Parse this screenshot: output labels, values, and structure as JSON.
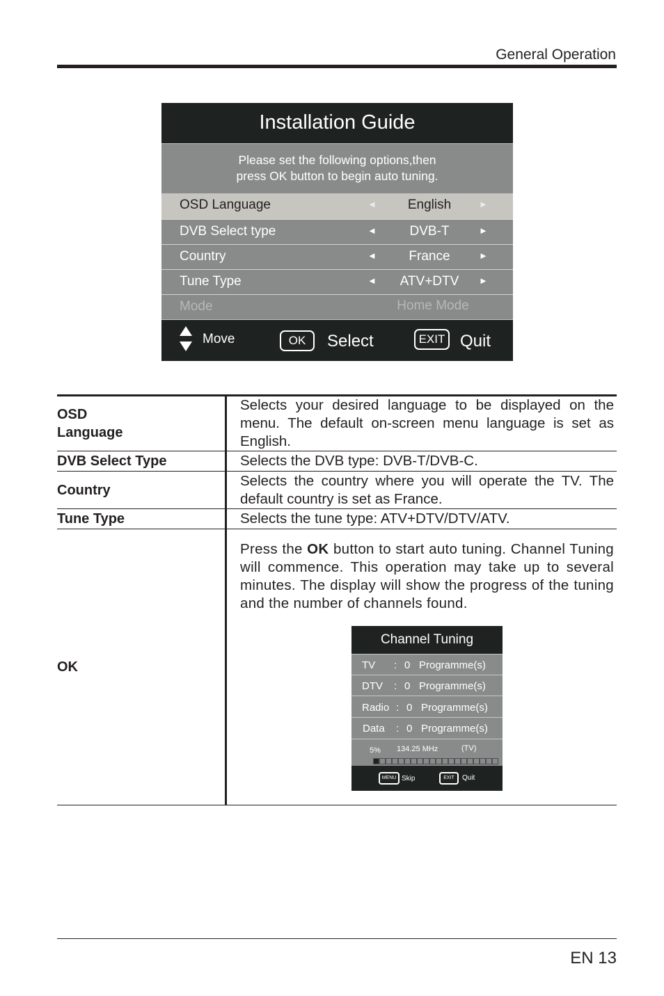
{
  "header": {
    "section": "General Operation"
  },
  "installation_guide": {
    "title": "Installation Guide",
    "message_line1": "Please set the following options,then",
    "message_line2": "press OK button to begin auto tuning.",
    "rows": [
      {
        "label": "OSD Language",
        "value": "English",
        "selected": true
      },
      {
        "label": "DVB Select type",
        "value": "DVB-T"
      },
      {
        "label": "Country",
        "value": "France"
      },
      {
        "label": "Tune Type",
        "value": "ATV+DTV"
      },
      {
        "label": "Mode",
        "value": "Home Mode",
        "disabled": true
      }
    ],
    "arrow_left": "◄",
    "arrow_right": "►",
    "footer": {
      "move_label": "Move",
      "ok_key": "OK",
      "select_label": "Select",
      "exit_key": "EXIT",
      "quit_label": "Quit"
    }
  },
  "table": {
    "rows": [
      {
        "term_line1": "OSD",
        "term_line2": "Language",
        "description": "Selects your desired language to be displayed on the menu. The default on-screen menu language is set as English."
      },
      {
        "term": "DVB Select Type",
        "description": "Selects the DVB type: DVB-T/DVB-C."
      },
      {
        "term": "Country",
        "description": "Selects the country where you will operate the TV. The default country is set as France."
      },
      {
        "term": "Tune Type",
        "description": "Selects the tune type: ATV+DTV/DTV/ATV."
      },
      {
        "term": "OK",
        "description_prefix": "Press the ",
        "description_bold": "OK",
        "description_suffix": " button to start auto tuning. Channel Tuning will commence. This operation may take up to several minutes. The display will show the progress of the tuning and the number of channels found."
      }
    ]
  },
  "channel_tuning": {
    "title": "Channel Tuning",
    "rows": [
      {
        "type": "TV",
        "sep": ":",
        "count": "0",
        "unit": "Programme(s)"
      },
      {
        "type": "DTV",
        "sep": ":",
        "count": "0",
        "unit": "Programme(s)"
      },
      {
        "type": "Radio",
        "sep": ":",
        "count": "0",
        "unit": "Programme(s)"
      },
      {
        "type": "Data",
        "sep": ":",
        "count": "0",
        "unit": "Programme(s)"
      }
    ],
    "progress_percent": "5%",
    "progress_value": 0.05,
    "progress_segments": 20,
    "frequency": "134.25 MHz",
    "source": "(TV)",
    "footer": {
      "menu_key": "MENU",
      "skip_label": "Skip",
      "exit_key": "EXIT",
      "quit_label": "Quit"
    }
  },
  "footer": {
    "page_number": "EN 13"
  }
}
